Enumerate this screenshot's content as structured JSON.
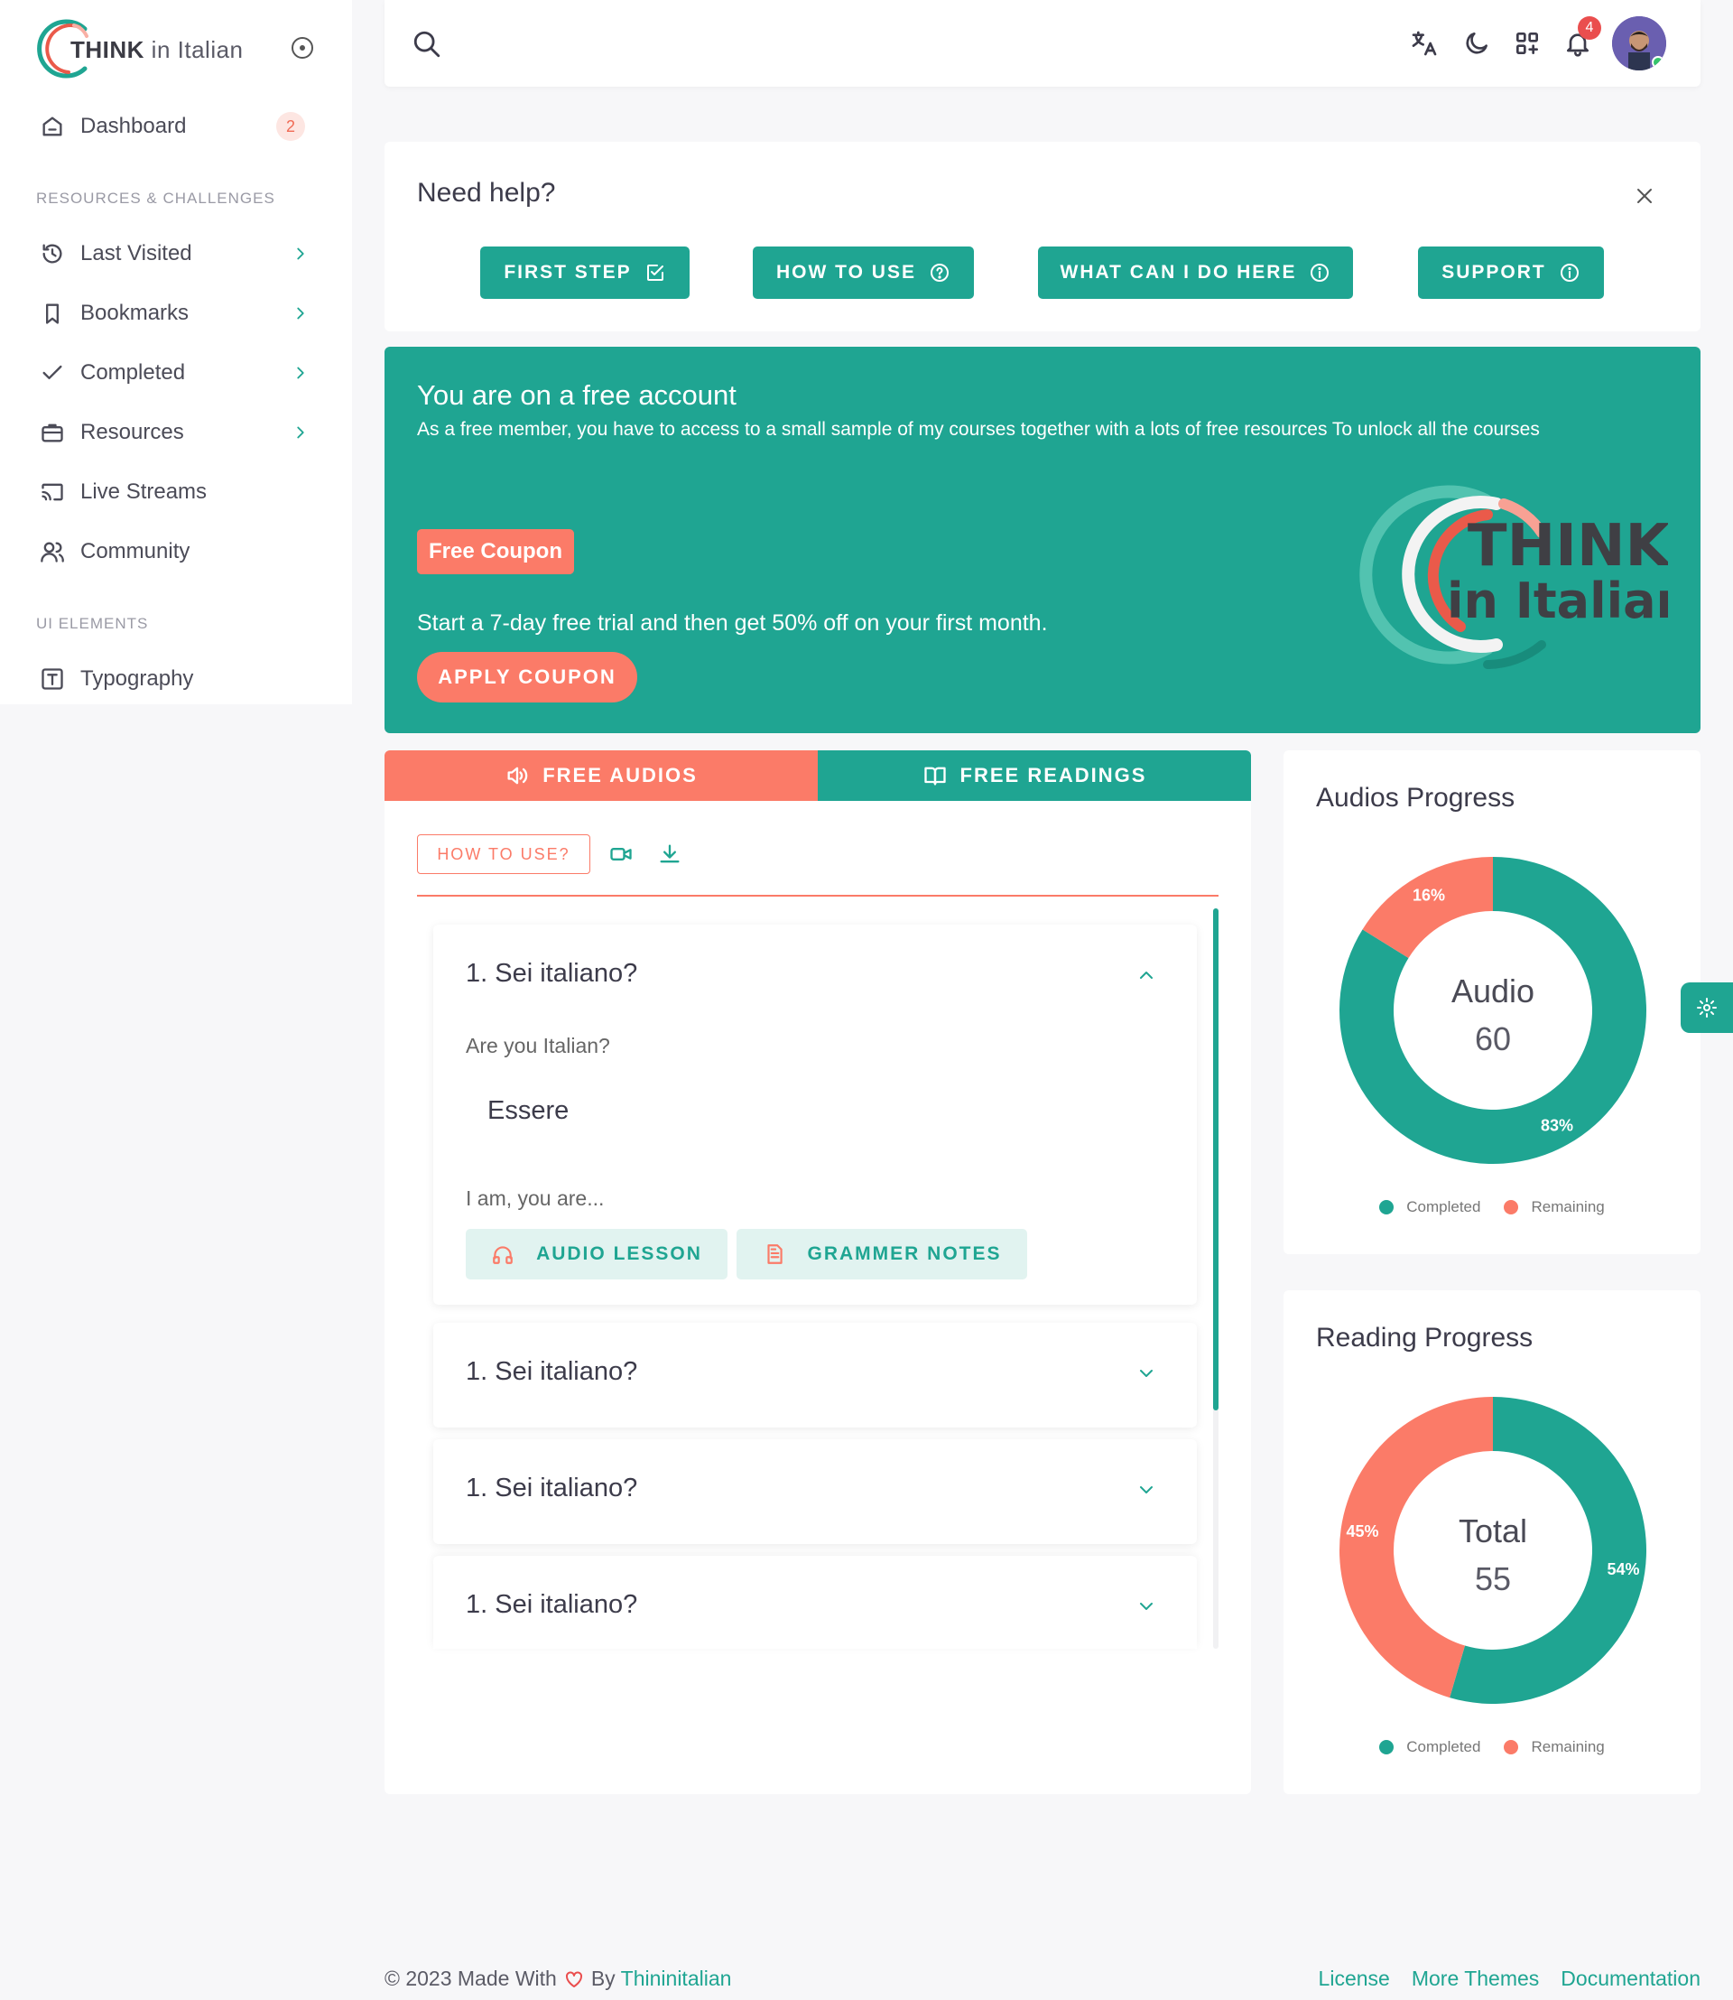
{
  "brand": {
    "name_bold": "THINK",
    "name_rest": "in Italian",
    "accent": "#1fa592",
    "coral": "#fb7b68"
  },
  "sidebar": {
    "dashboard": {
      "label": "Dashboard",
      "badge": "2"
    },
    "section1": "RESOURCES & CHALLENGES",
    "items": [
      {
        "label": "Last Visited",
        "icon": "history-icon"
      },
      {
        "label": "Bookmarks",
        "icon": "bookmark-icon"
      },
      {
        "label": "Completed",
        "icon": "check-icon"
      },
      {
        "label": "Resources",
        "icon": "briefcase-icon"
      },
      {
        "label": "Live Streams",
        "icon": "cast-icon"
      },
      {
        "label": "Community",
        "icon": "users-icon"
      }
    ],
    "section2": "UI ELEMENTS",
    "ui_items": [
      {
        "label": "Typography",
        "icon": "text-icon"
      }
    ]
  },
  "topbar": {
    "notifications": "4"
  },
  "help": {
    "title": "Need help?",
    "buttons": [
      "FIRST STEP",
      "HOW TO USE",
      "WHAT CAN I DO HERE",
      "SUPPORT"
    ]
  },
  "banner": {
    "title": "You are on a free account",
    "subtitle": "As a free member, you have to access to a small sample of my courses together with a lots of free resources To unlock all the courses",
    "coupon_tag": "Free Coupon",
    "description": "Start a 7-day free trial and then get 50% off on your first month.",
    "apply": "APPLY COUPON",
    "logo_line1": "THINK",
    "logo_line2": "in Italian"
  },
  "tabs": {
    "audios": "FREE AUDIOS",
    "readings": "FREE READINGS"
  },
  "toolbar": {
    "how_to_use": "HOW TO USE?"
  },
  "lessons": [
    {
      "title": "1. Sei italiano?",
      "subtitle": "Are you Italian?",
      "word": "Essere",
      "meaning": "I am, you are...",
      "expanded": true,
      "buttons": [
        "AUDIO LESSON",
        "GRAMMER NOTES"
      ]
    },
    {
      "title": "1. Sei italiano?"
    },
    {
      "title": "1. Sei italiano?"
    },
    {
      "title": "1. Sei italiano?"
    }
  ],
  "audios_progress": {
    "title": "Audios Progress",
    "center_label": "Audio",
    "center_value": "60",
    "chart_data": {
      "type": "pie",
      "categories": [
        "Completed",
        "Remaining"
      ],
      "values": [
        83,
        16
      ],
      "labels": [
        "83%",
        "16%"
      ],
      "colors": [
        "#1fa592",
        "#fb7b68"
      ]
    }
  },
  "reading_progress": {
    "title": "Reading Progress",
    "center_label": "Total",
    "center_value": "55",
    "chart_data": {
      "type": "pie",
      "categories": [
        "Completed",
        "Remaining"
      ],
      "values": [
        54,
        45
      ],
      "labels": [
        "54%",
        "45%"
      ],
      "colors": [
        "#1fa592",
        "#fb7b68"
      ]
    }
  },
  "legend": {
    "completed": "Completed",
    "remaining": "Remaining"
  },
  "footer": {
    "left_prefix": "© 2023 Made With",
    "by": "By",
    "author": "Thininitalian",
    "links": [
      "License",
      "More Themes",
      "Documentation"
    ]
  }
}
